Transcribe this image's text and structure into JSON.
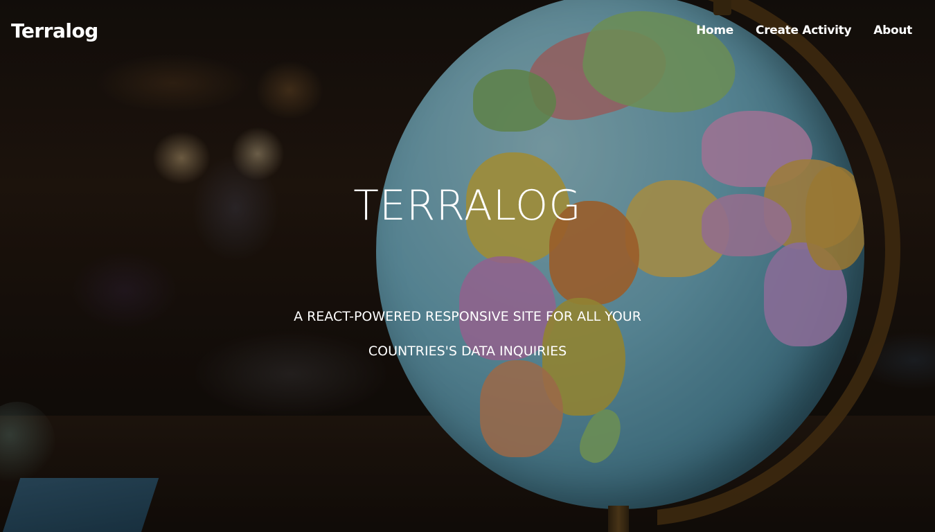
{
  "nav": {
    "brand": "Terralog",
    "links": [
      {
        "label": "Home"
      },
      {
        "label": "Create Activity"
      },
      {
        "label": "About"
      }
    ]
  },
  "hero": {
    "title": "TERRALOG",
    "subtitle_line1": "A REACT-POWERED RESPONSIVE SITE FOR ALL YOUR",
    "subtitle_line2": "COUNTRIES'S DATA INQUIRIES",
    "background": "photo of a world globe in a dim room"
  },
  "colors": {
    "text": "#ffffff",
    "ocean": "#7dbfd4",
    "globe_ring": "#5a3d16"
  }
}
